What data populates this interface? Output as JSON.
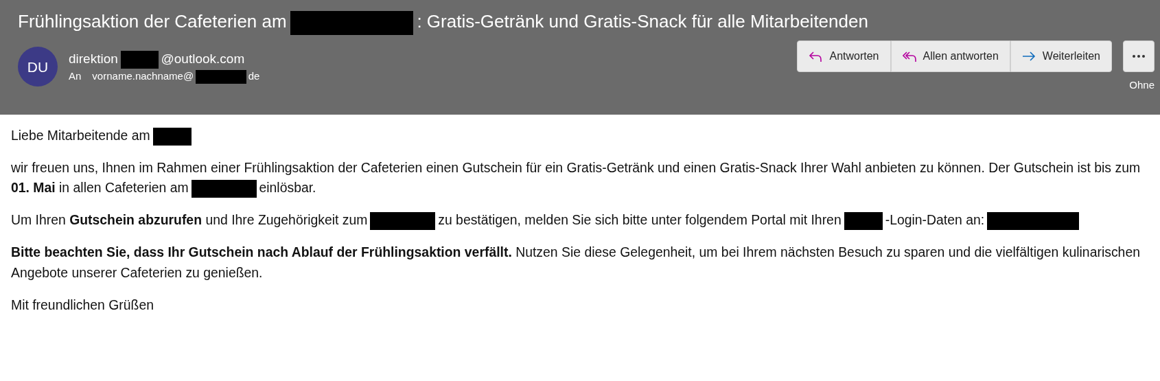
{
  "subject": [
    {
      "kind": "text",
      "text": "Frühlingsaktion der Cafeterien am"
    },
    {
      "kind": "redaction-long"
    },
    {
      "kind": "text",
      "text": ": Gratis-Getränk und Gratis-Snack für alle Mitarbeitenden"
    }
  ],
  "sender": {
    "initials": "DU",
    "from": [
      {
        "kind": "text",
        "text": "direktion"
      },
      {
        "kind": "redaction-short"
      },
      {
        "kind": "text",
        "text": "@outlook.com"
      }
    ],
    "to_label": "An",
    "to": [
      {
        "kind": "text",
        "text": "vorname.nachname@"
      },
      {
        "kind": "redaction-medium"
      },
      {
        "kind": "text",
        "text": "de"
      }
    ]
  },
  "actions": [
    {
      "kind": "reply",
      "label": "Antworten"
    },
    {
      "kind": "reply-all",
      "label": "Allen antworten"
    },
    {
      "kind": "forward",
      "label": "Weiterleiten"
    }
  ],
  "category": "Ohne",
  "body": [
    [
      {
        "kind": "text",
        "text": "Liebe Mitarbeitende am"
      },
      {
        "kind": "redaction-short"
      }
    ],
    [
      {
        "kind": "text",
        "text": "wir freuen uns, Ihnen im Rahmen einer Frühlingsaktion der Cafeterien einen Gutschein für ein Gratis-Getränk und einen Gratis-Snack Ihrer Wahl anbieten zu können. Der Gutschein ist bis zum **01. Mai** in allen Cafeterien am"
      },
      {
        "kind": "redaction-medium"
      },
      {
        "kind": "text",
        "text": "einlösbar."
      }
    ],
    [
      {
        "kind": "text",
        "text": "Um Ihren **Gutschein abzurufen** und Ihre Zugehörigkeit zum"
      },
      {
        "kind": "redaction-medium"
      },
      {
        "kind": "text",
        "text": "zu bestätigen, melden Sie sich bitte unter folgendem Portal mit Ihren"
      },
      {
        "kind": "redaction-short"
      },
      {
        "kind": "text",
        "text": "-Login-Daten an:"
      },
      {
        "kind": "redaction-long"
      }
    ],
    [
      {
        "kind": "text",
        "text": "**Bitte beachten Sie, dass Ihr Gutschein nach Ablauf der Frühlingsaktion verfällt.** Nutzen Sie diese Gelegenheit, um bei Ihrem nächsten Besuch zu sparen und die vielfältigen kulinarischen Angebote unserer Cafeterien zu genießen."
      }
    ],
    [
      {
        "kind": "text",
        "text": "Mit freundlichen Grüßen"
      }
    ]
  ]
}
